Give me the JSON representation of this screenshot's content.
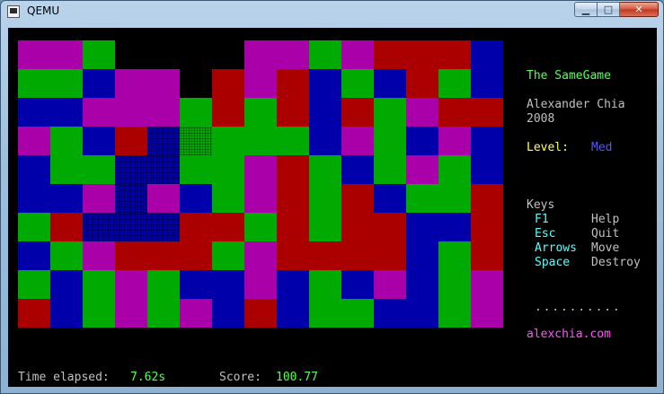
{
  "window": {
    "title": "QEMU",
    "buttons": {
      "minimize": "▁",
      "maximize": "□",
      "close": "✕"
    }
  },
  "game": {
    "title": "The SameGame",
    "author": "Alexander Chia",
    "year": "2008",
    "level_label": "Level:",
    "level_value": "Med",
    "keys_heading": "Keys",
    "keys": [
      {
        "key": "F1",
        "action": "Help"
      },
      {
        "key": "Esc",
        "action": "Quit"
      },
      {
        "key": "Arrows",
        "action": "Move"
      },
      {
        "key": "Space",
        "action": "Destroy"
      }
    ],
    "dots": ". . . . . . . . . .",
    "website": "alexchia.com",
    "time_label": "Time elapsed:",
    "time_value": "7.62s",
    "score_label": "Score:",
    "score_value": "100.77"
  },
  "colors": {
    "M": "#aa00aa",
    "G": "#00aa00",
    "B": "#0000aa",
    "R": "#aa0000",
    "K": "#000000"
  },
  "board": {
    "cols": 15,
    "rows": 10,
    "grid": [
      "MMGKKKKMMGMRRRB",
      "GGBMMKRMRBGBRGB",
      "BBMMMGRGRBRGMRR",
      "MGBRBGGGGBMGBMB",
      "BGGBBGGMRGBGMGB",
      "BBMBMBGMRGRBGGR",
      "GRBBBRRGRGRRBBR",
      "BGMRRRGMRRRRBGR",
      "GBGMGBBMBGBMBGM",
      "RBGMGMBRBGGBBGM"
    ],
    "selected": [
      [
        3,
        4
      ],
      [
        3,
        5
      ],
      [
        4,
        3
      ],
      [
        4,
        4
      ],
      [
        5,
        3
      ],
      [
        6,
        2
      ],
      [
        6,
        3
      ],
      [
        6,
        4
      ]
    ]
  }
}
